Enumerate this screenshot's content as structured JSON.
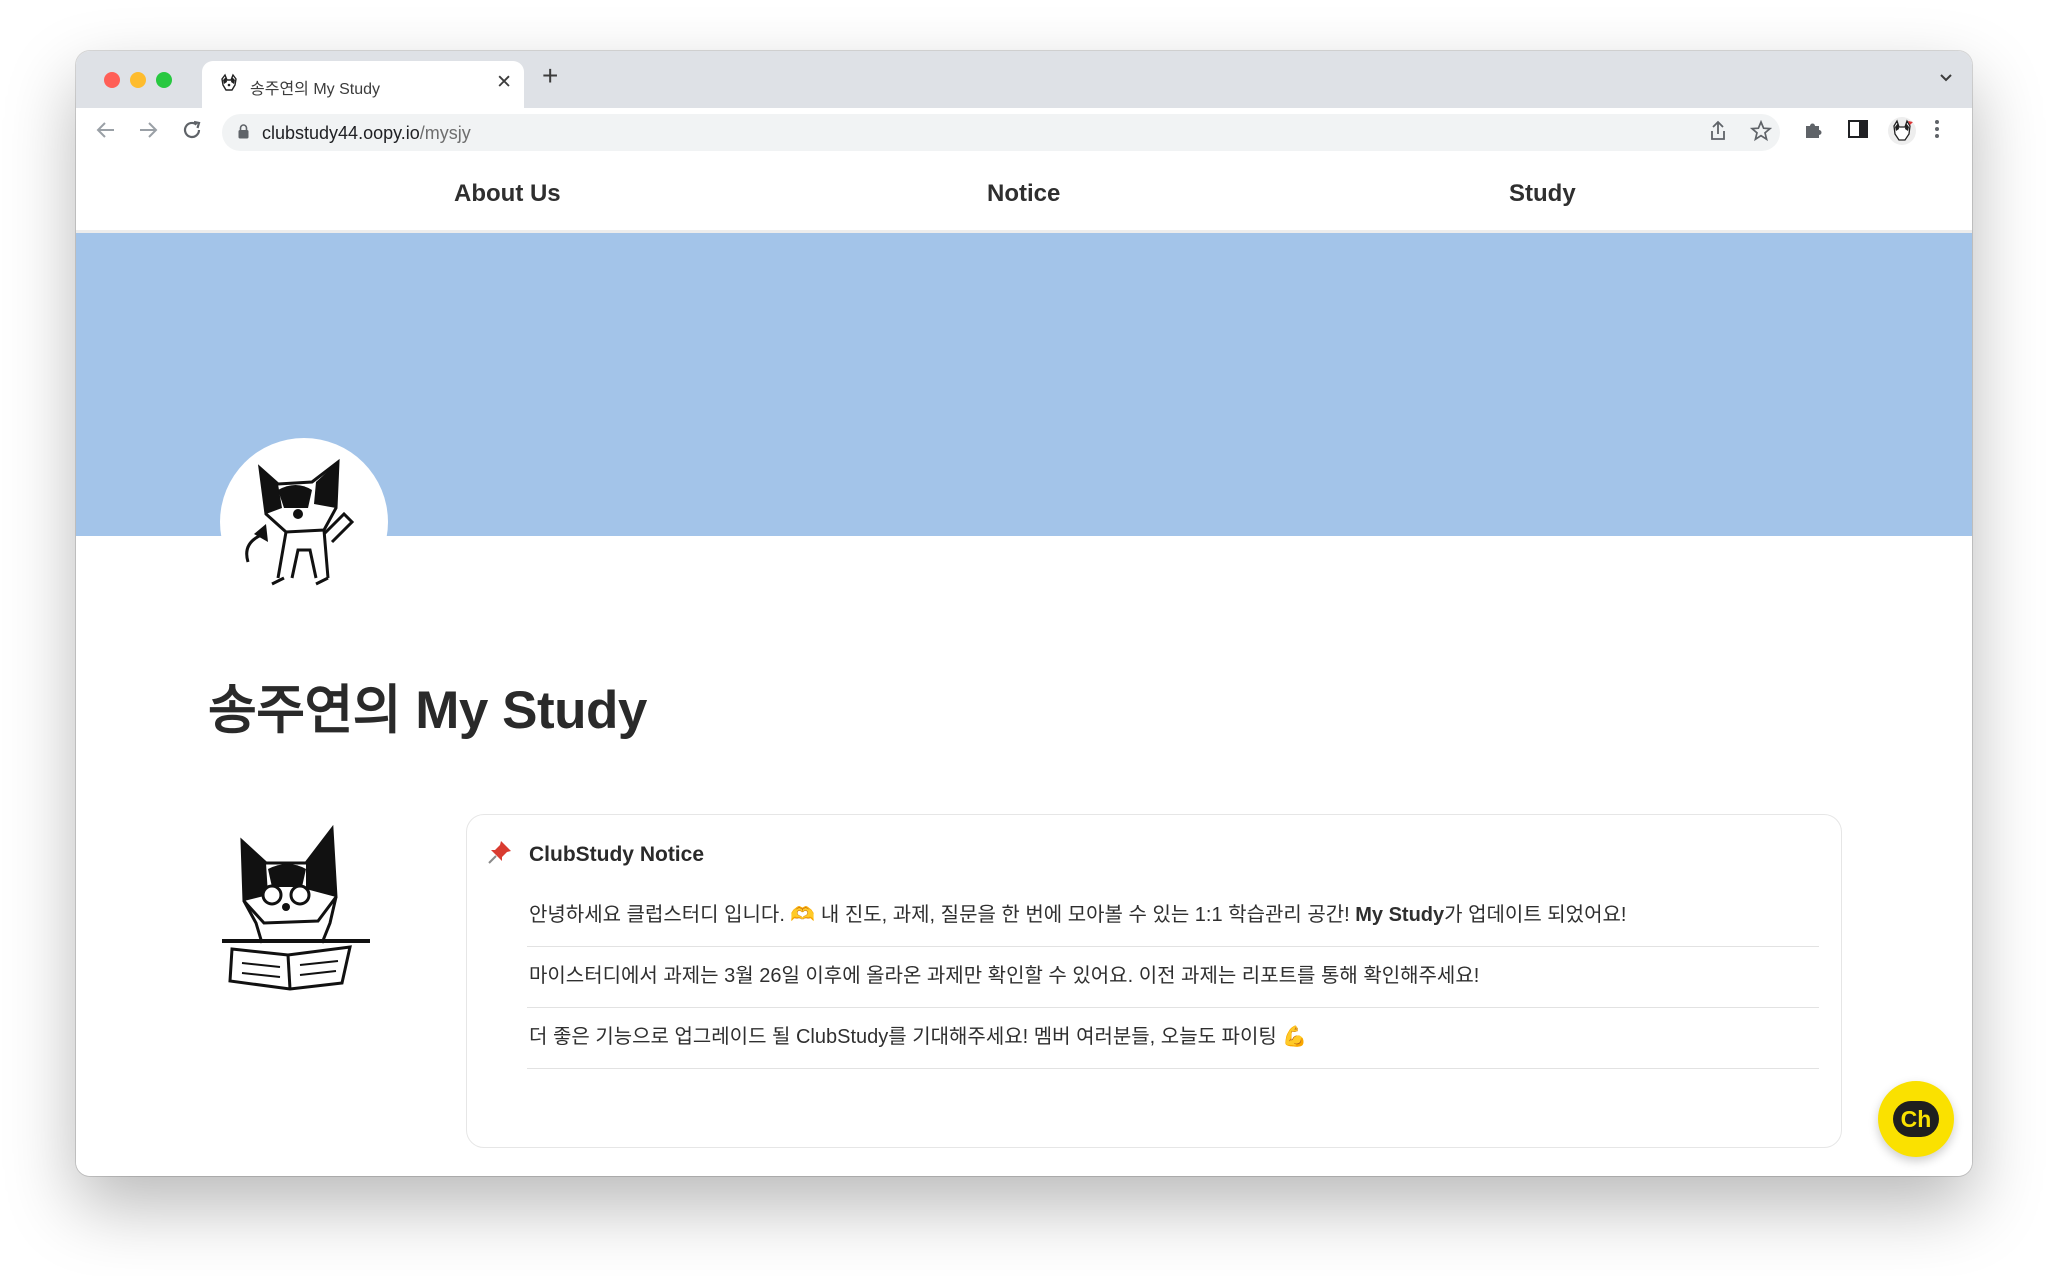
{
  "browser": {
    "tab_title": "송주연의 My Study",
    "tab_close": "✕",
    "new_tab": "+",
    "url_host": "clubstudy44.oopy.io",
    "url_path": "/mysjy"
  },
  "nav": {
    "items": [
      {
        "label": "About Us"
      },
      {
        "label": "Notice"
      },
      {
        "label": "Study"
      }
    ]
  },
  "colors": {
    "banner": "#a3c4e9",
    "channel_button": "#fae100"
  },
  "page": {
    "title": "송주연의 My Study"
  },
  "notice": {
    "icon": "pushpin-icon",
    "title": "ClubStudy Notice",
    "line1_pre": "안녕하세요 클럽스터디 입니다. 🫶 내 진도, 과제, 질문을 한 번에 모아볼 수 있는 1:1 학습관리 공간! ",
    "line1_bold": "My Study",
    "line1_post": "가 업데이트 되었어요!",
    "line2": "마이스터디에서 과제는 3월 26일 이후에 올라온 과제만 확인할 수 있어요. 이전 과제는 리포트를 통해 확인해주세요!",
    "line3": "더 좋은 기능으로 업그레이드 될 ClubStudy를 기대해주세요! 멤버 여러분들, 오늘도 파이팅 💪"
  },
  "channel": {
    "label": "Ch"
  }
}
